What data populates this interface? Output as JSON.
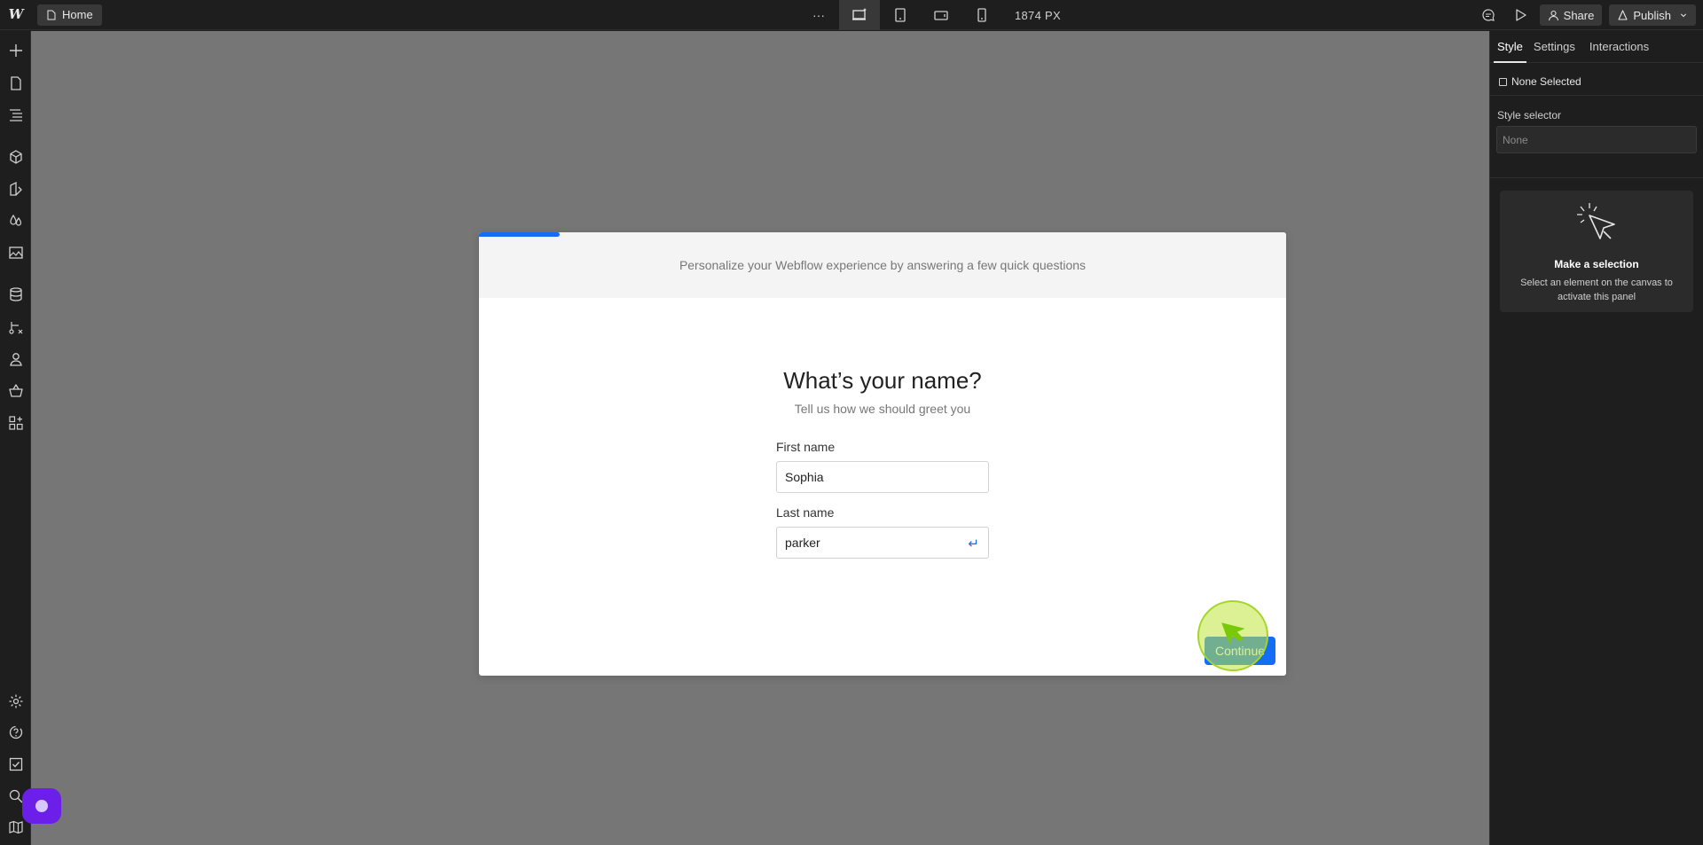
{
  "topbar": {
    "logo": "W",
    "page_name": "Home",
    "more_label": "···",
    "width_label": "1874 PX",
    "share_label": "Share",
    "publish_label": "Publish"
  },
  "modal": {
    "header": "Personalize your Webflow experience by answering a few quick questions",
    "progress_fraction": 0.1,
    "title": "What’s your name?",
    "subtitle": "Tell us how we should greet you",
    "first_name_label": "First name",
    "first_name_value": "Sophia",
    "last_name_label": "Last name",
    "last_name_value": "parker",
    "enter_glyph": "↵",
    "continue_label": "Continue"
  },
  "right_panel": {
    "tabs": [
      "Style",
      "Settings",
      "Interactions"
    ],
    "none_selected": "None Selected",
    "style_selector_label": "Style selector",
    "style_selector_value": "None",
    "card_title": "Make a selection",
    "card_text": "Select an element on the canvas to activate this panel"
  },
  "colors": {
    "accent": "#146ef5",
    "canvas": "#767676",
    "chrome": "#1e1e1e",
    "assistant": "#6b1fe8"
  },
  "icons": {
    "left_sidebar": [
      "plus-icon",
      "page-icon",
      "navigator-icon",
      "components-icon",
      "style-guide-icon",
      "variables-icon",
      "assets-icon",
      "cms-icon",
      "logic-icon",
      "users-icon",
      "ecommerce-icon",
      "apps-icon",
      "settings-icon",
      "help-icon",
      "audit-icon",
      "search-icon",
      "map-icon"
    ]
  }
}
